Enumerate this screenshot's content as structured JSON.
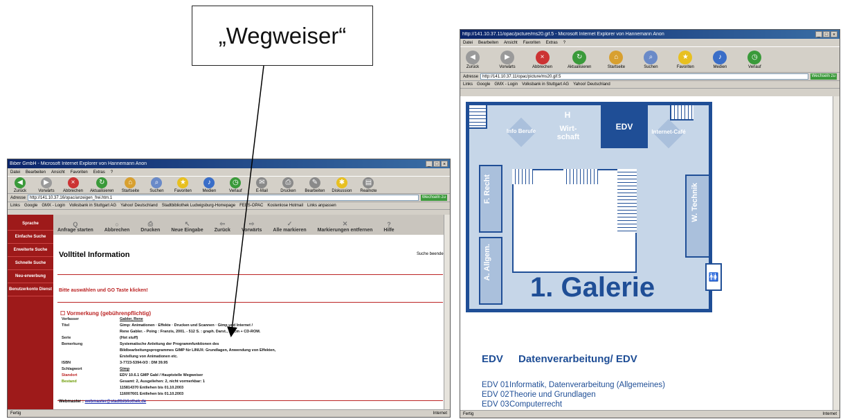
{
  "callout": {
    "text": "„Wegweiser“"
  },
  "left_window": {
    "title": "Biber GmbH - Microsoft Internet Explorer von Hannemann Anon",
    "menu": [
      "Datei",
      "Bearbeiten",
      "Ansicht",
      "Favoriten",
      "Extras",
      "?"
    ],
    "toolbar": [
      "Zurück",
      "Vorwärts",
      "Abbrechen",
      "Aktualisieren",
      "Startseite",
      "Suchen",
      "Favoriten",
      "Medien",
      "Verlauf",
      "E-Mail",
      "Drucken",
      "Bearbeiten",
      "Diskussion",
      "Realnote"
    ],
    "address_label": "Adresse",
    "address": "http://141.10.37.16/opac/anzeigen_frei.htm.1",
    "go": "Wechseln zu",
    "links_label": "Links",
    "links": [
      "Google",
      "GMX - Login",
      "Volksbank in Stuttgart AG",
      "Yahoo! Deutschland",
      "Stadtbibliothek Ludwigsburg-Homepage",
      "FEES-OPAC",
      "Kostenlose Hotmail",
      "Links anpassen"
    ],
    "sidebar": [
      "Sprache",
      "Einfache Suche",
      "Erweiterte Suche",
      "Schnelle Suche",
      "Neu-erwerbung",
      "Benutzerkonto Dienst"
    ],
    "content_toolbar": [
      {
        "icon": "Q",
        "label": "Anfrage starten"
      },
      {
        "icon": "○",
        "label": "Abbrechen"
      },
      {
        "icon": "⎙",
        "label": "Drucken"
      },
      {
        "icon": "↖",
        "label": "Neue Eingabe"
      },
      {
        "icon": "⇦",
        "label": "Zurück"
      },
      {
        "icon": "⇨",
        "label": "Vorwärts"
      },
      {
        "icon": "✓",
        "label": "Alle markieren"
      },
      {
        "icon": "✕",
        "label": "Markierungen entfernen"
      },
      {
        "icon": "?",
        "label": "Hilfe"
      }
    ],
    "page_title": "Volltitel Information",
    "page_right": "Suche beenden",
    "warning": "Bitte auswählen und GO Taste klicken!",
    "vormerkung": "Vormerkung (gebührenpflichtig)",
    "record": [
      {
        "key": "Verfasser",
        "value": "Gabler, Rene",
        "cls": "lnk"
      },
      {
        "key": "Titel",
        "value": "Gimp: Animationen · Effekte · Drucken und Scannen · Gimp und Internet /",
        "cls": ""
      },
      {
        "key": "",
        "value": "Rene Gabler. - Poing : Franzis, 2001. - 512 S. : graph. Darst., 24 cm + CD-ROM.",
        "cls": ""
      },
      {
        "key": "Serie",
        "value": "(Hot stuff)",
        "cls": ""
      },
      {
        "key": "Bemerkung",
        "value": "Systematische Anleitung der Programmfunktionen des",
        "cls": ""
      },
      {
        "key": "",
        "value": "Bildbearbeitungsprogrammes GIMP für LINUX: Grundlagen, Anwendung von Effekten,",
        "cls": ""
      },
      {
        "key": "",
        "value": "Erstellung von Animationen etc.",
        "cls": ""
      },
      {
        "key": "ISBN",
        "value": "3-7723-5394-0/3 : DM 39.95",
        "cls": ""
      },
      {
        "key": "Schlagwort",
        "value": "Gimp",
        "cls": "lnk"
      },
      {
        "key": "Standort",
        "value": "EDV 10.6.1 GMP Gabl / Hauptstelle Wegweiser",
        "cls": ""
      },
      {
        "key": "Bestand",
        "value": "Gesamt: 2, Ausgeliehen: 2, nicht vormerkbar: 1",
        "cls": ""
      },
      {
        "key": "",
        "value": "115814370 Entliehen bis 01.10.2003",
        "cls": "org"
      },
      {
        "key": "",
        "value": "116007601 Entliehen bis 01.10.2003",
        "cls": "org"
      }
    ],
    "webmaster_label": "Webmaster :",
    "webmaster_link": "webmaster@stadtbibliothek.de",
    "status_left": "Fertig",
    "status_right": "Internet"
  },
  "right_window": {
    "title": "http://141.10.37.11/opac/picture/ms20.gif.5 - Microsoft Internet Explorer von Hannemann Anon",
    "menu": [
      "Datei",
      "Bearbeiten",
      "Ansicht",
      "Favoriten",
      "Extras",
      "?"
    ],
    "toolbar": [
      "Zurück",
      "Vorwärts",
      "Abbrechen",
      "Aktualisieren",
      "Startseite",
      "Suchen",
      "Favoriten",
      "Medien",
      "Verlauf"
    ],
    "address_label": "Adresse",
    "address": "http://141.10.37.11/opac/picture/ms20.gif.5",
    "go": "Wechseln zu",
    "links_label": "Links",
    "links": [
      "Google",
      "GMX - Login",
      "Volksbank in Stuttgart AG",
      "Yahoo! Deutschland"
    ],
    "map": {
      "edv": "EDV",
      "info_berufe": "Info Berufe",
      "wirtschaft": "Wirt-schaft",
      "wirtschaft_letter": "H",
      "internet_cafe": "Internet-Café",
      "recht": "F. Recht",
      "allgem": "A. Allgem.",
      "technik": "W. Technik",
      "galerie": "1. Galerie",
      "wc_icon": "🚻"
    },
    "legend_code": "EDV",
    "legend_title": "Datenverarbeitung/ EDV",
    "legend_rows": [
      {
        "code": "EDV 01",
        "text": "Informatik, Datenverarbeitung (Allgemeines)"
      },
      {
        "code": "EDV 02",
        "text": "Theorie und Grundlagen"
      },
      {
        "code": "EDV 03",
        "text": "Computerrecht"
      }
    ],
    "status_left": "Fertig",
    "status_right": "Internet"
  },
  "colors": {
    "brand_red": "#9e1a1a",
    "map_blue": "#1f4e96",
    "link_blue": "#1a2fb0"
  }
}
